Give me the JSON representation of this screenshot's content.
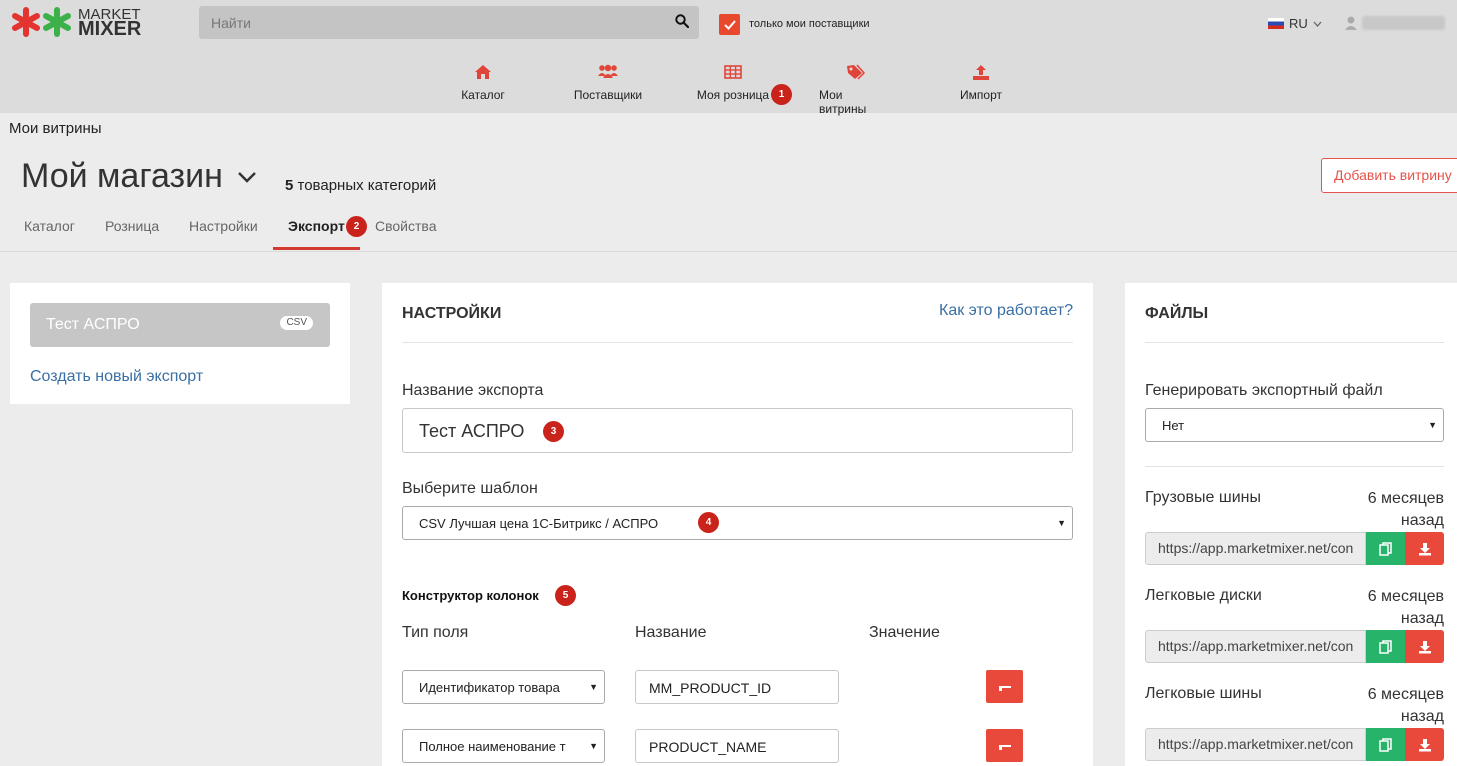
{
  "logo": {
    "line1": "MARKET",
    "line2": "MIXER"
  },
  "search": {
    "placeholder": "Найти"
  },
  "only_my_suppliers": "только мои поставщики",
  "lang": "RU",
  "nav": [
    {
      "label": "Каталог",
      "icon": "home-icon"
    },
    {
      "label": "Поставщики",
      "icon": "users-icon"
    },
    {
      "label": "Моя розница",
      "icon": "table-icon",
      "badge": "1"
    },
    {
      "label": "Мои витрины",
      "icon": "tags-icon"
    },
    {
      "label": "Импорт",
      "icon": "upload-icon"
    }
  ],
  "breadcrumb": "Мои витрины",
  "shop": {
    "title": "Мой магазин",
    "count": "5",
    "count_label": "товарных категорий"
  },
  "add_showcase": "Добавить витрину",
  "tabs": [
    {
      "label": "Каталог"
    },
    {
      "label": "Розница"
    },
    {
      "label": "Настройки"
    },
    {
      "label": "Экспорт",
      "badge": "2",
      "active": true
    },
    {
      "label": "Свойства"
    }
  ],
  "exports": {
    "item": "Тест АСПРО",
    "tag": "CSV",
    "create_new": "Создать новый экспорт"
  },
  "settings": {
    "title": "НАСТРОЙКИ",
    "help_link": "Как это работает?",
    "name_label": "Название экспорта",
    "name_value": "Тест АСПРО",
    "name_badge": "3",
    "template_label": "Выберите шаблон",
    "template_value": "CSV Лучшая цена 1С-Битрикс / АСПРО",
    "template_badge": "4",
    "constructor_label": "Конструктор колонок",
    "constructor_badge": "5",
    "col_headers": {
      "type": "Тип поля",
      "name": "Название",
      "value": "Значение"
    },
    "rows": [
      {
        "type": "Идентификатор товара",
        "name": "MM_PRODUCT_ID"
      },
      {
        "type": "Полное наименование т",
        "name": "PRODUCT_NAME"
      }
    ]
  },
  "files": {
    "title": "ФАЙЛЫ",
    "generate_label": "Генерировать экспортный файл",
    "generate_value": "Нет",
    "items": [
      {
        "name": "Грузовые шины",
        "age1": "6 месяцев",
        "age2": "назад",
        "url": "https://app.marketmixer.net/con"
      },
      {
        "name": "Легковые диски",
        "age1": "6 месяцев",
        "age2": "назад",
        "url": "https://app.marketmixer.net/con"
      },
      {
        "name": "Легковые шины",
        "age1": "6 месяцев",
        "age2": "назад",
        "url": "https://app.marketmixer.net/con"
      }
    ]
  },
  "colors": {
    "accent": "#e8493b",
    "badge": "#c9231b",
    "link": "#3a6fa3",
    "copy": "#27b46a"
  }
}
